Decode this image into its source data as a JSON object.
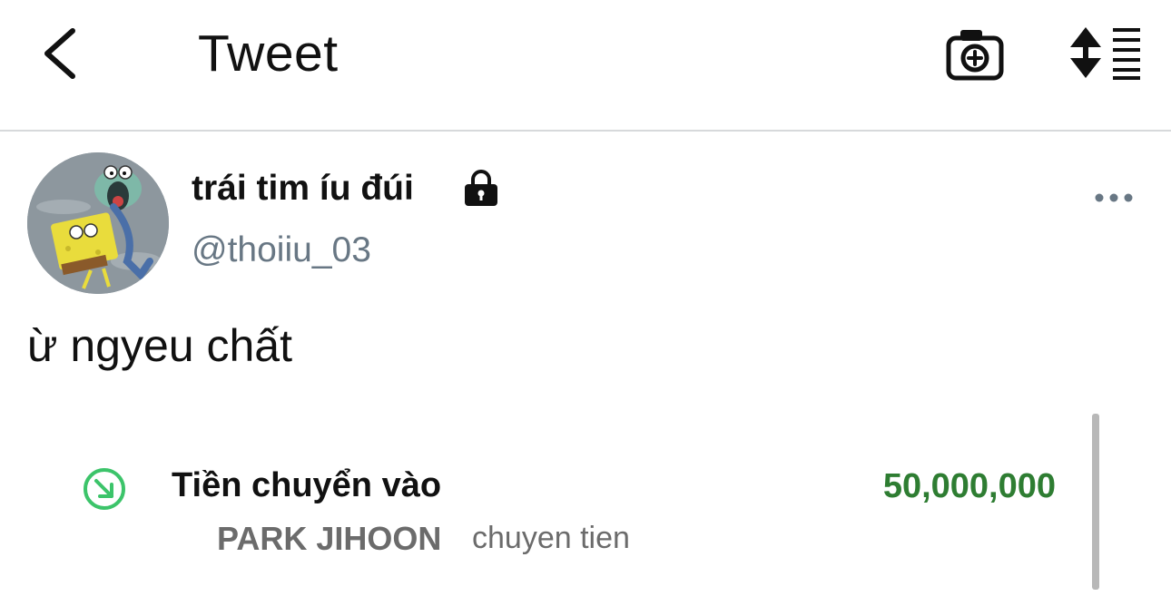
{
  "header": {
    "title": "Tweet",
    "back_icon": "chevron-left-icon",
    "camera_icon": "camera-add-icon",
    "sort_icon": "sort-list-icon"
  },
  "tweet": {
    "author": {
      "display_name": "trái tim íu đúi",
      "handle": "@thoiiu_03",
      "protected_icon": "lock-icon",
      "avatar_icon": "avatar-cartoon-image"
    },
    "more_icon": "more-dots-icon",
    "text": "ừ ngyeu chất",
    "attachment": {
      "direction_icon": "incoming-arrow-icon",
      "title": "Tiền chuyển vào",
      "amount": "50,000,000",
      "sender": "PARK JIHOON",
      "memo": "chuyen tien"
    }
  },
  "colors": {
    "text_primary": "#111111",
    "text_secondary": "#687784",
    "amount_green": "#2e7d32",
    "icon_green": "#3cc46a",
    "divider": "#d7d9db"
  }
}
